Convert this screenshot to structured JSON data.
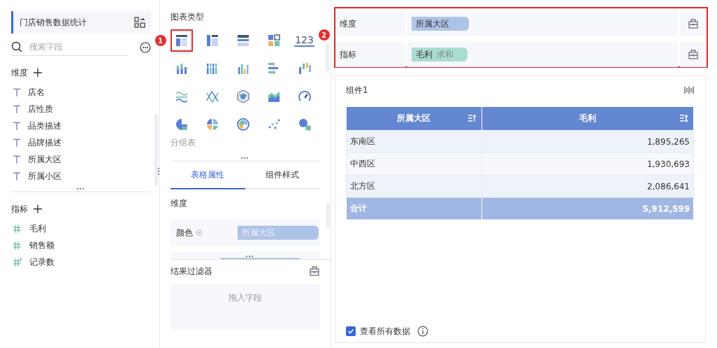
{
  "dataset": {
    "title": "门店销售数据统计"
  },
  "search": {
    "placeholder": "搜索字段"
  },
  "dimensions": {
    "title": "维度",
    "fields": [
      "店名",
      "店性质",
      "品类描述",
      "品牌描述",
      "所属大区",
      "所属小区"
    ]
  },
  "measures": {
    "title": "指标",
    "fields": [
      {
        "name": "毛利",
        "kind": "number"
      },
      {
        "name": "销售额",
        "kind": "number"
      },
      {
        "name": "记录数",
        "kind": "count"
      }
    ]
  },
  "chart_panel": {
    "title": "图表类型",
    "hint": "分组表",
    "types": [
      {
        "kind": "table",
        "selected": true
      },
      {
        "kind": "cross",
        "selected": false
      },
      {
        "kind": "detail",
        "selected": false
      },
      {
        "kind": "card",
        "selected": false
      },
      {
        "kind": "number",
        "label": "123",
        "selected": false
      },
      {
        "kind": "stack",
        "selected": false
      },
      {
        "kind": "group",
        "selected": false
      },
      {
        "kind": "column",
        "selected": false
      },
      {
        "kind": "bar",
        "selected": false
      },
      {
        "kind": "range",
        "selected": false
      },
      {
        "kind": "wave",
        "selected": false
      },
      {
        "kind": "cross-line",
        "selected": false
      },
      {
        "kind": "radar",
        "selected": false
      },
      {
        "kind": "area",
        "selected": false
      },
      {
        "kind": "gauge",
        "selected": false
      },
      {
        "kind": "pie",
        "selected": false
      },
      {
        "kind": "pie2",
        "selected": false
      },
      {
        "kind": "rose",
        "selected": false
      },
      {
        "kind": "scatter",
        "selected": false
      },
      {
        "kind": "bubble",
        "selected": false
      }
    ]
  },
  "property_tabs": [
    {
      "label": "表格属性",
      "selected": true
    },
    {
      "label": "组件样式",
      "selected": false
    }
  ],
  "properties": {
    "title": "维度",
    "rows": [
      {
        "label": "颜色",
        "value": "所属大区"
      }
    ]
  },
  "result_filter": {
    "title": "结果过滤器",
    "placeholder": "拖入字段"
  },
  "shelves": [
    {
      "label": "维度",
      "pills": [
        {
          "name": "所属大区",
          "kind": "dimension"
        }
      ]
    },
    {
      "label": "指标",
      "pills": [
        {
          "name": "毛利",
          "agg": "求和",
          "kind": "measure"
        }
      ]
    }
  ],
  "annotations": [
    "1",
    "2"
  ],
  "widget": {
    "title": "组件1",
    "table": {
      "columns": [
        {
          "label": "所属大区",
          "sorted": true
        },
        {
          "label": "毛利",
          "sorted": false
        }
      ],
      "rows": [
        [
          "东南区",
          "1,895,265"
        ],
        [
          "中西区",
          "1,930,693"
        ],
        [
          "北方区",
          "2,086,641"
        ]
      ],
      "total": [
        "合计",
        "5,912,599"
      ]
    },
    "show_all": {
      "label": "查看所有数据",
      "checked": true
    }
  }
}
